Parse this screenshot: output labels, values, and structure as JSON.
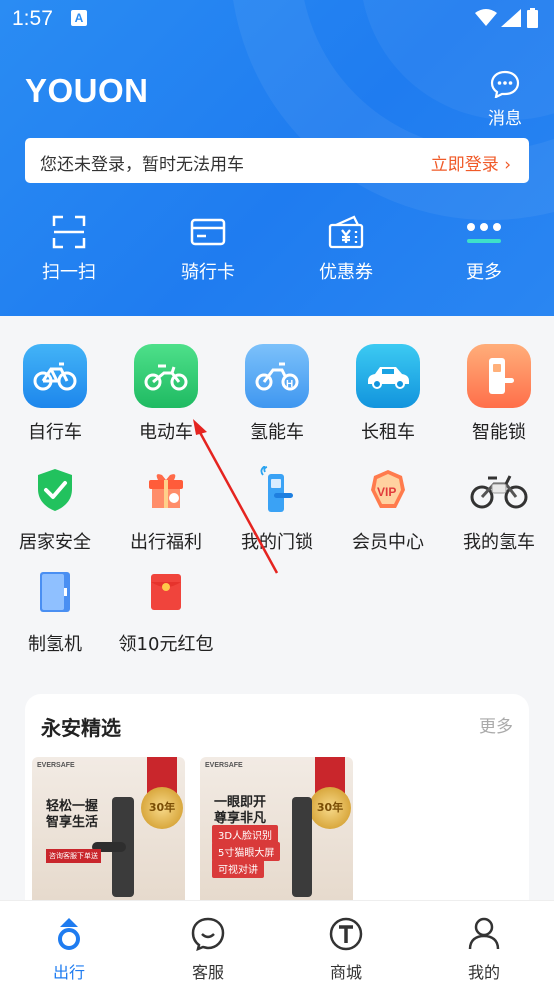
{
  "status_bar": {
    "time": "1:57"
  },
  "header": {
    "logo": "YOUON",
    "message_label": "消息",
    "login_tip": "您还未登录，暂时无法用车",
    "login_action": "立即登录",
    "quick_actions": [
      {
        "label": "扫一扫",
        "icon": "scan-icon"
      },
      {
        "label": "骑行卡",
        "icon": "card-icon"
      },
      {
        "label": "优惠券",
        "icon": "coupon-icon"
      },
      {
        "label": "更多",
        "icon": "more-icon"
      }
    ]
  },
  "apps_row1": [
    {
      "label": "自行车",
      "icon": "bicycle-icon",
      "color": "#2196f3"
    },
    {
      "label": "电动车",
      "icon": "ebike-icon",
      "color": "#2ecc71"
    },
    {
      "label": "氢能车",
      "icon": "hydrogen-bike-icon",
      "color": "#5aa9f5"
    },
    {
      "label": "长租车",
      "icon": "car-icon",
      "color": "#1da1e8"
    },
    {
      "label": "智能锁",
      "icon": "smart-lock-icon",
      "color": "#ff8a5c"
    }
  ],
  "apps_row2": [
    {
      "label": "居家安全",
      "icon": "shield-icon"
    },
    {
      "label": "出行福利",
      "icon": "gift-icon"
    },
    {
      "label": "我的门锁",
      "icon": "door-lock-icon"
    },
    {
      "label": "会员中心",
      "icon": "vip-icon"
    },
    {
      "label": "我的氢车",
      "icon": "my-bike-icon"
    }
  ],
  "apps_row3": [
    {
      "label": "制氢机",
      "icon": "hydrogen-machine-icon"
    },
    {
      "label": "领10元红包",
      "icon": "red-packet-icon"
    }
  ],
  "featured": {
    "title": "永安精选",
    "more": "更多",
    "products": [
      {
        "brand": "EVERSAFE",
        "headline": "轻松一握\n智享生活",
        "badge": "30年",
        "tag": "咨询客服下单送"
      },
      {
        "brand": "EVERSAFE",
        "headline": "一眼即开\n尊享非凡",
        "badge": "30年",
        "features": [
          "3D人脸识别",
          "5寸猫眼大屏",
          "可视对讲"
        ]
      }
    ]
  },
  "bottom_nav": [
    {
      "label": "出行",
      "icon": "ride-icon",
      "active": true
    },
    {
      "label": "客服",
      "icon": "service-icon",
      "active": false
    },
    {
      "label": "商城",
      "icon": "mall-icon",
      "active": false
    },
    {
      "label": "我的",
      "icon": "profile-icon",
      "active": false
    }
  ],
  "colors": {
    "brand_blue": "#1f7cf0",
    "login_action": "#f05a28",
    "arrow_annotation": "#e52420"
  }
}
